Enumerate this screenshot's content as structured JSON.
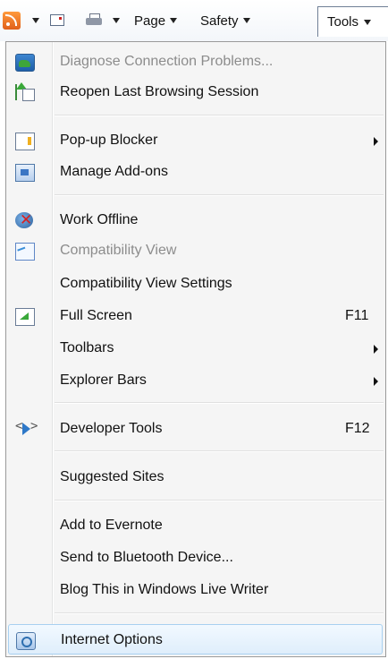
{
  "command_bar": {
    "page_label": "Page",
    "safety_label": "Safety",
    "tools_label": "Tools",
    "icons": [
      "rss-feed-icon",
      "read-mail-icon",
      "print-icon"
    ]
  },
  "menu": {
    "items": [
      {
        "label": "Diagnose Connection Problems...",
        "icon": "diagnose-connection-icon",
        "disabled": true
      },
      {
        "label": "Reopen Last Browsing Session",
        "icon": "reopen-session-icon"
      },
      {
        "label": "Pop-up Blocker",
        "icon": "popup-blocker-icon",
        "submenu": true
      },
      {
        "label": "Manage Add-ons",
        "icon": "manage-addons-icon"
      },
      {
        "label": "Work Offline",
        "icon": "work-offline-icon"
      },
      {
        "label": "Compatibility View",
        "icon": "compatibility-view-icon",
        "disabled": true
      },
      {
        "label": "Compatibility View Settings"
      },
      {
        "label": "Full Screen",
        "icon": "full-screen-icon",
        "shortcut": "F11"
      },
      {
        "label": "Toolbars",
        "submenu": true
      },
      {
        "label": "Explorer Bars",
        "submenu": true
      },
      {
        "label": "Developer Tools",
        "icon": "developer-tools-icon",
        "shortcut": "F12"
      },
      {
        "label": "Suggested Sites"
      },
      {
        "label": "Add to Evernote"
      },
      {
        "label": "Send to Bluetooth Device..."
      },
      {
        "label": "Blog This in Windows Live Writer"
      },
      {
        "label": "Internet Options",
        "icon": "internet-options-icon",
        "highlighted": true
      }
    ]
  }
}
